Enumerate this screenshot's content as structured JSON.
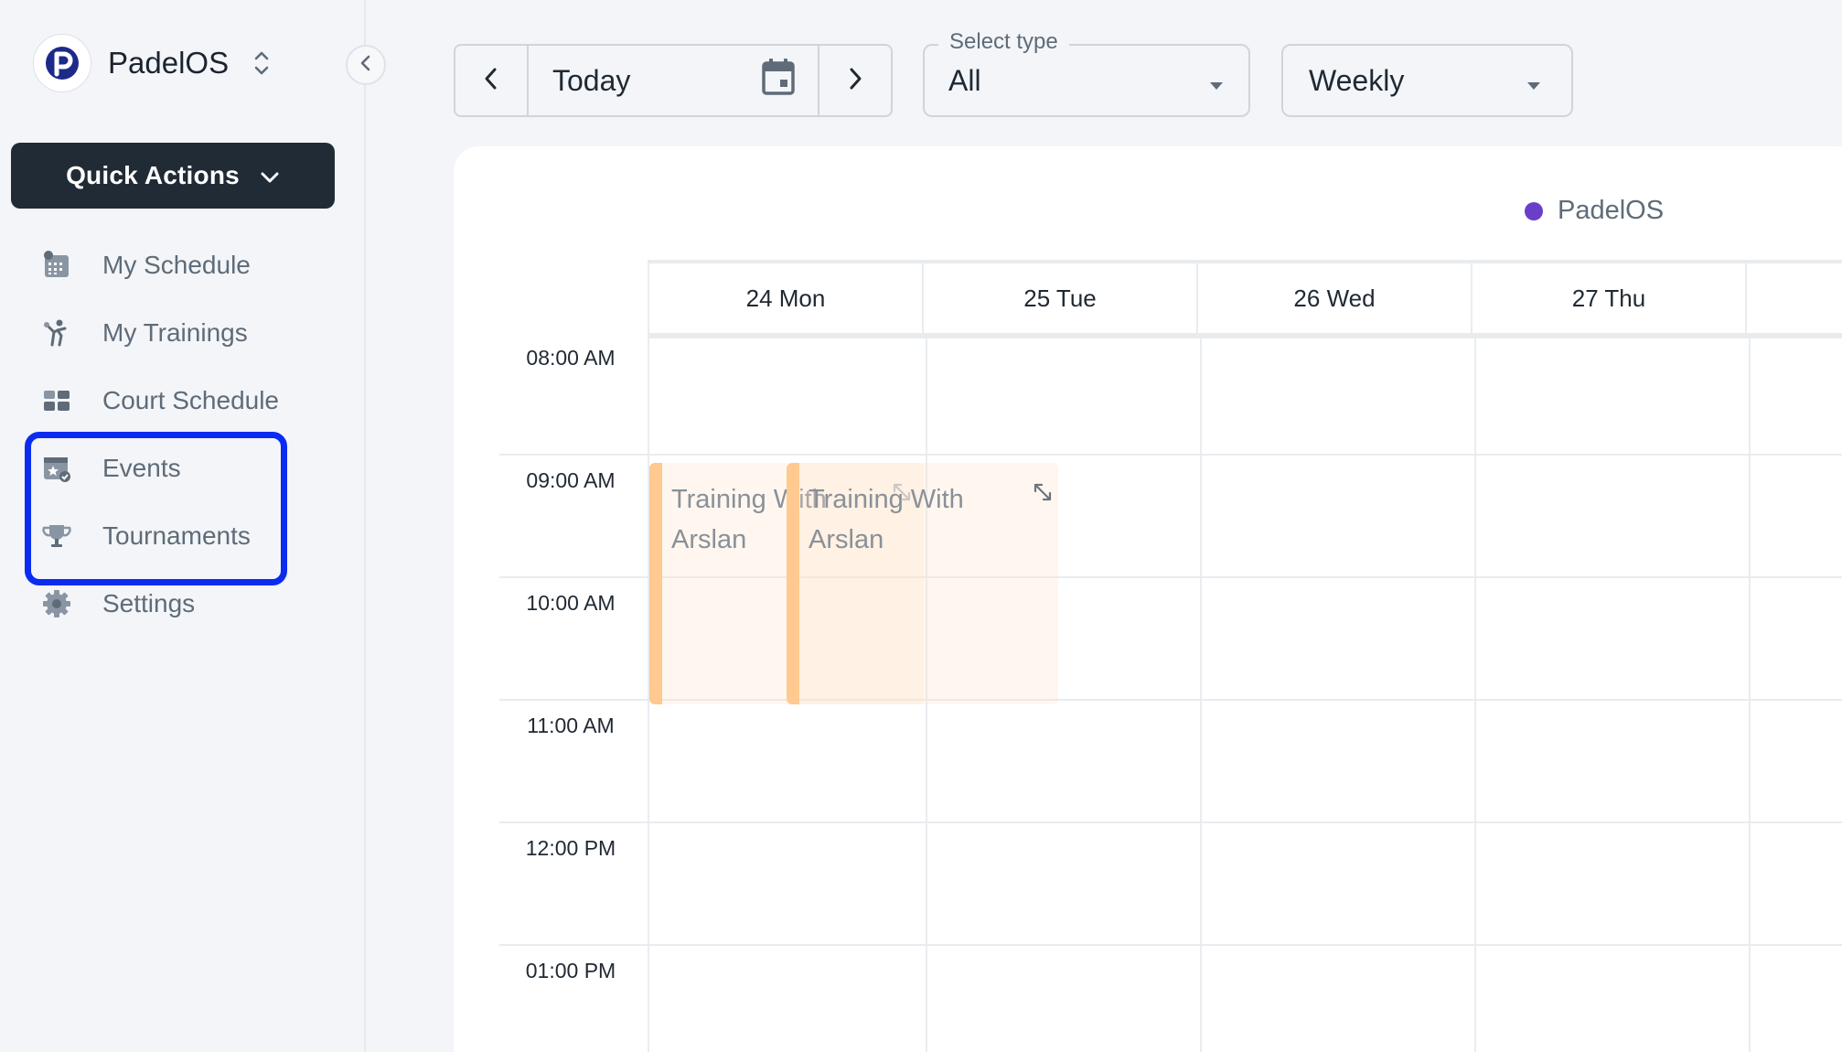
{
  "app": {
    "name": "PadelOS"
  },
  "sidebar": {
    "quick_actions_label": "Quick Actions",
    "items": [
      {
        "label": "My Schedule",
        "icon": "calendar-grid-icon"
      },
      {
        "label": "My Trainings",
        "icon": "player-icon"
      },
      {
        "label": "Court Schedule",
        "icon": "dashboard-grid-icon"
      },
      {
        "label": "Events",
        "icon": "event-star-icon"
      },
      {
        "label": "Tournaments",
        "icon": "trophy-icon"
      },
      {
        "label": "Settings",
        "icon": "gear-icon"
      }
    ]
  },
  "toolbar": {
    "today_label": "Today",
    "select_type_legend": "Select type",
    "select_type_value": "All",
    "view_value": "Weekly"
  },
  "calendar": {
    "legend_label": "PadelOS",
    "legend_color": "#6a3fc7",
    "days": [
      "24 Mon",
      "25 Tue",
      "26 Wed",
      "27 Thu"
    ],
    "times": [
      "08:00 AM",
      "09:00 AM",
      "10:00 AM",
      "11:00 AM",
      "12:00 PM",
      "01:00 PM"
    ],
    "events": [
      {
        "title_line1": "Training With",
        "title_line2": "Arslan"
      },
      {
        "title_line1": "Training With",
        "title_line2": "Arslan"
      }
    ],
    "event_color": "#ffc98f"
  },
  "highlight": {
    "color": "#0a2bf0"
  }
}
